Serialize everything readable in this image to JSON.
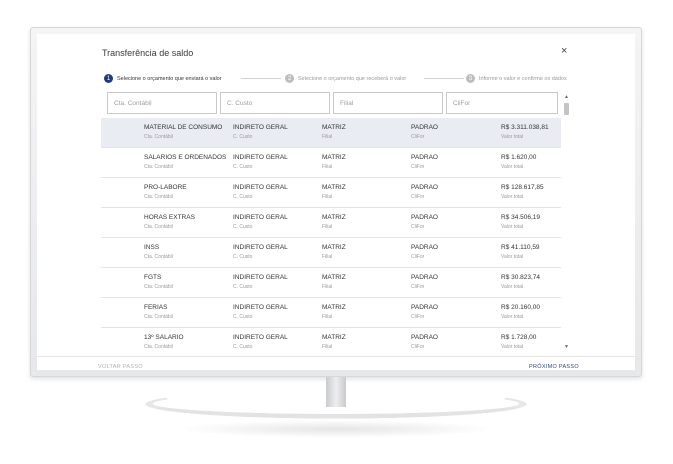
{
  "dialog": {
    "title": "Transferência de saldo",
    "close_glyph": "×"
  },
  "steps": [
    {
      "number": "1",
      "label": "Selecione o orçamento que enviará o valor",
      "active": true
    },
    {
      "number": "2",
      "label": "Selecione o orçamento que receberá o valor",
      "active": false
    },
    {
      "number": "3",
      "label": "Informe o valor e confirme os dados",
      "active": false
    }
  ],
  "filters": [
    {
      "placeholder": "Cta. Contábil"
    },
    {
      "placeholder": "C. Custo"
    },
    {
      "placeholder": "Filial"
    },
    {
      "placeholder": "CliFor"
    }
  ],
  "row_sublabels": [
    "Cta. Contábil",
    "C. Custo",
    "Filial",
    "CliFor",
    "Valor total"
  ],
  "rows": [
    {
      "conta": "MATERIAL DE CONSUMO",
      "custo": "INDIRETO GERAL",
      "filial": "MATRIZ",
      "clifor": "PADRAO",
      "valor": "R$ 3.311.038,81",
      "selected": true
    },
    {
      "conta": "SALARIOS E ORDENADOS",
      "custo": "INDIRETO GERAL",
      "filial": "MATRIZ",
      "clifor": "PADRAO",
      "valor": "R$ 1.620,00"
    },
    {
      "conta": "PRO-LABORE",
      "custo": "INDIRETO GERAL",
      "filial": "MATRIZ",
      "clifor": "PADRAO",
      "valor": "R$ 128.617,85"
    },
    {
      "conta": "HORAS EXTRAS",
      "custo": "INDIRETO GERAL",
      "filial": "MATRIZ",
      "clifor": "PADRAO",
      "valor": "R$ 34.506,19"
    },
    {
      "conta": "INSS",
      "custo": "INDIRETO GERAL",
      "filial": "MATRIZ",
      "clifor": "PADRAO",
      "valor": "R$ 41.110,59"
    },
    {
      "conta": "FGTS",
      "custo": "INDIRETO GERAL",
      "filial": "MATRIZ",
      "clifor": "PADRAO",
      "valor": "R$ 30.823,74"
    },
    {
      "conta": "FERIAS",
      "custo": "INDIRETO GERAL",
      "filial": "MATRIZ",
      "clifor": "PADRAO",
      "valor": "R$ 20.160,00"
    },
    {
      "conta": "13º SALARIO",
      "custo": "INDIRETO GERAL",
      "filial": "MATRIZ",
      "clifor": "PADRAO",
      "valor": "R$ 1.728,00"
    }
  ],
  "footer": {
    "back_label": "VOLTAR PASSO",
    "next_label": "PRÓXIMO PASSO"
  },
  "colors": {
    "accent": "#1f3d7a",
    "selected_row": "#e9ecf2",
    "link": "#2b4a86"
  }
}
